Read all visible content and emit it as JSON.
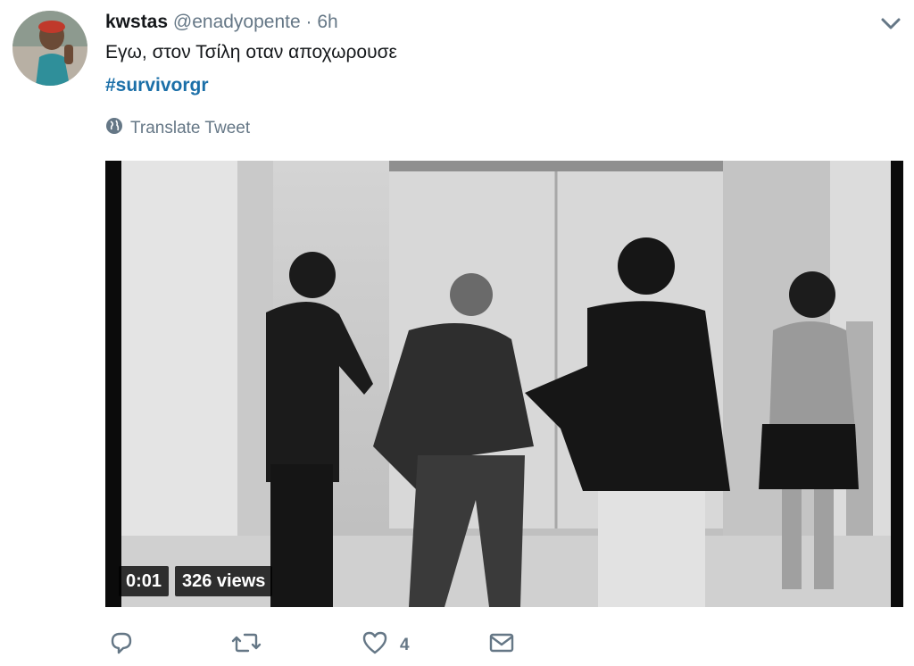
{
  "tweet": {
    "display_name": "kwstas",
    "handle": "@enadyopente",
    "separator": "·",
    "time": "6h",
    "text": "Εγω, στον Τσίλη οταν αποχωρουσε",
    "hashtag": "#survivorgr",
    "translate_label": "Translate Tweet"
  },
  "media": {
    "type": "video",
    "timestamp": "0:01",
    "views": "326 views"
  },
  "actions": {
    "reply_icon": "reply-icon",
    "retweet_icon": "retweet-icon",
    "like_icon": "heart-icon",
    "like_count": "4",
    "dm_icon": "envelope-icon"
  },
  "colors": {
    "link": "#1b6fa8",
    "muted": "#657786",
    "text": "#14171a"
  }
}
